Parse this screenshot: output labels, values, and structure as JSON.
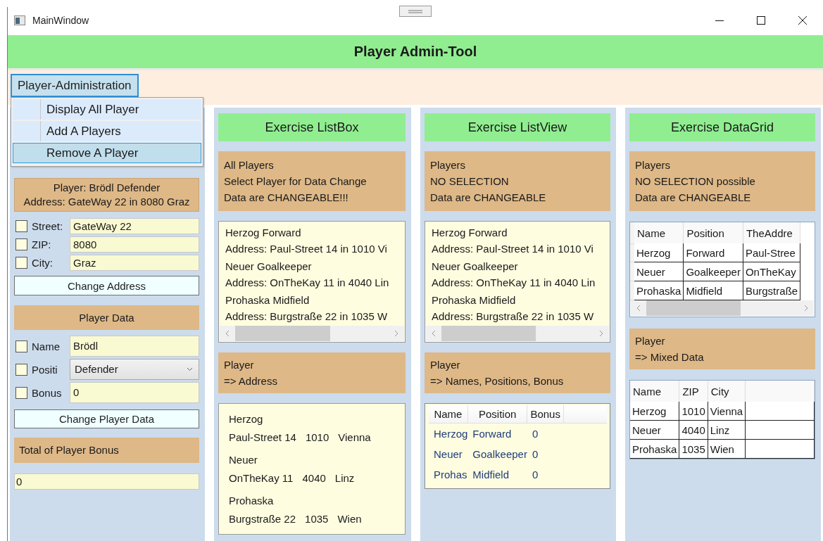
{
  "window": {
    "title": "MainWindow"
  },
  "header": {
    "title": "Player Admin-Tool"
  },
  "menu": {
    "label": "Player-Administration",
    "open": true,
    "items": [
      {
        "label": "Display All Player",
        "selected": false
      },
      {
        "label": "Add A Players",
        "selected": false
      },
      {
        "label": "Remove A Player",
        "selected": true
      }
    ]
  },
  "player_panel": {
    "summary": [
      "Player: Brödl Defender",
      "Address: GateWay 22 in 8080 Graz"
    ],
    "address_fields": [
      {
        "label": "Street:",
        "value": "GateWay 22",
        "checked": false
      },
      {
        "label": "ZIP:",
        "value": "8080",
        "checked": false
      },
      {
        "label": "City:",
        "value": "Graz",
        "checked": false
      }
    ],
    "address_button": "Change Address",
    "data_header": "Player Data",
    "data_fields": [
      {
        "kind": "text",
        "label": "Name",
        "value": "Brödl",
        "checked": false
      },
      {
        "kind": "combo",
        "label": "Positi",
        "value": "Defender",
        "checked": false
      },
      {
        "kind": "text",
        "label": "Bonus",
        "value": "0",
        "checked": false
      }
    ],
    "data_button": "Change Player Data",
    "total_header": "Total of Player Bonus",
    "total_value": "0"
  },
  "listbox_panel": {
    "title": "Exercise ListBox",
    "info": [
      "All Players",
      "Select Player for Data Change",
      "Data are CHANGEABLE!!!"
    ],
    "players": [
      {
        "name_line": "Herzog Forward",
        "address_line": "Address: Paul-Street 14 in 1010 Vi"
      },
      {
        "name_line": "Neuer Goalkeeper",
        "address_line": "Address: OnTheKay 11 in 4040 Lin"
      },
      {
        "name_line": "Prohaska Midfield",
        "address_line": "Address: Burgstraße 22 in 1035 W"
      }
    ],
    "detail_header": [
      "Player",
      "=> Address"
    ],
    "details": [
      {
        "name": "Herzog",
        "street": "Paul-Street 14",
        "zip": "1010",
        "city": "Vienna"
      },
      {
        "name": "Neuer",
        "street": "OnTheKay 11",
        "zip": "4040",
        "city": "Linz"
      },
      {
        "name": "Prohaska",
        "street": "Burgstraße 22",
        "zip": "1035",
        "city": "Wien"
      }
    ]
  },
  "listview_panel": {
    "title": "Exercise ListView",
    "info": [
      "Players",
      "NO SELECTION",
      "Data are CHANGEABLE"
    ],
    "players": [
      {
        "name_line": "Herzog Forward",
        "address_line": "Address: Paul-Street 14 in 1010 Vi"
      },
      {
        "name_line": "Neuer Goalkeeper",
        "address_line": "Address: OnTheKay 11 in 4040 Lin"
      },
      {
        "name_line": "Prohaska Midfield",
        "address_line": "Address: Burgstraße 22 in 1035 W"
      }
    ],
    "detail_header": [
      "Player",
      "=> Names, Positions, Bonus"
    ],
    "table": {
      "columns": [
        "Name",
        "Position",
        "Bonus"
      ],
      "rows": [
        [
          "Herzog",
          "Forward",
          "0"
        ],
        [
          "Neuer",
          "Goalkeeper",
          "0"
        ],
        [
          "Prohas",
          "Midfield",
          "0"
        ]
      ]
    }
  },
  "datagrid_panel": {
    "title": "Exercise DataGrid",
    "info": [
      "Players",
      "NO SELECTION possible",
      "Data are CHANGEABLE"
    ],
    "table": {
      "columns": [
        "Name",
        "Position",
        "TheAddre"
      ],
      "rows": [
        [
          "Herzog",
          "Forward",
          "Paul-Stree"
        ],
        [
          "Neuer",
          "Goalkeeper",
          "OnTheKay"
        ],
        [
          "Prohaska",
          "Midfield",
          "Burgstraße"
        ]
      ]
    },
    "detail_header": [
      "Player",
      "=> Mixed Data"
    ],
    "table2": {
      "columns": [
        "Name",
        "ZIP",
        "City"
      ],
      "rows": [
        [
          "Herzog",
          "1010",
          "Vienna"
        ],
        [
          "Neuer",
          "4040",
          "Linz"
        ],
        [
          "Prohaska",
          "1035",
          "Wien"
        ]
      ]
    }
  }
}
